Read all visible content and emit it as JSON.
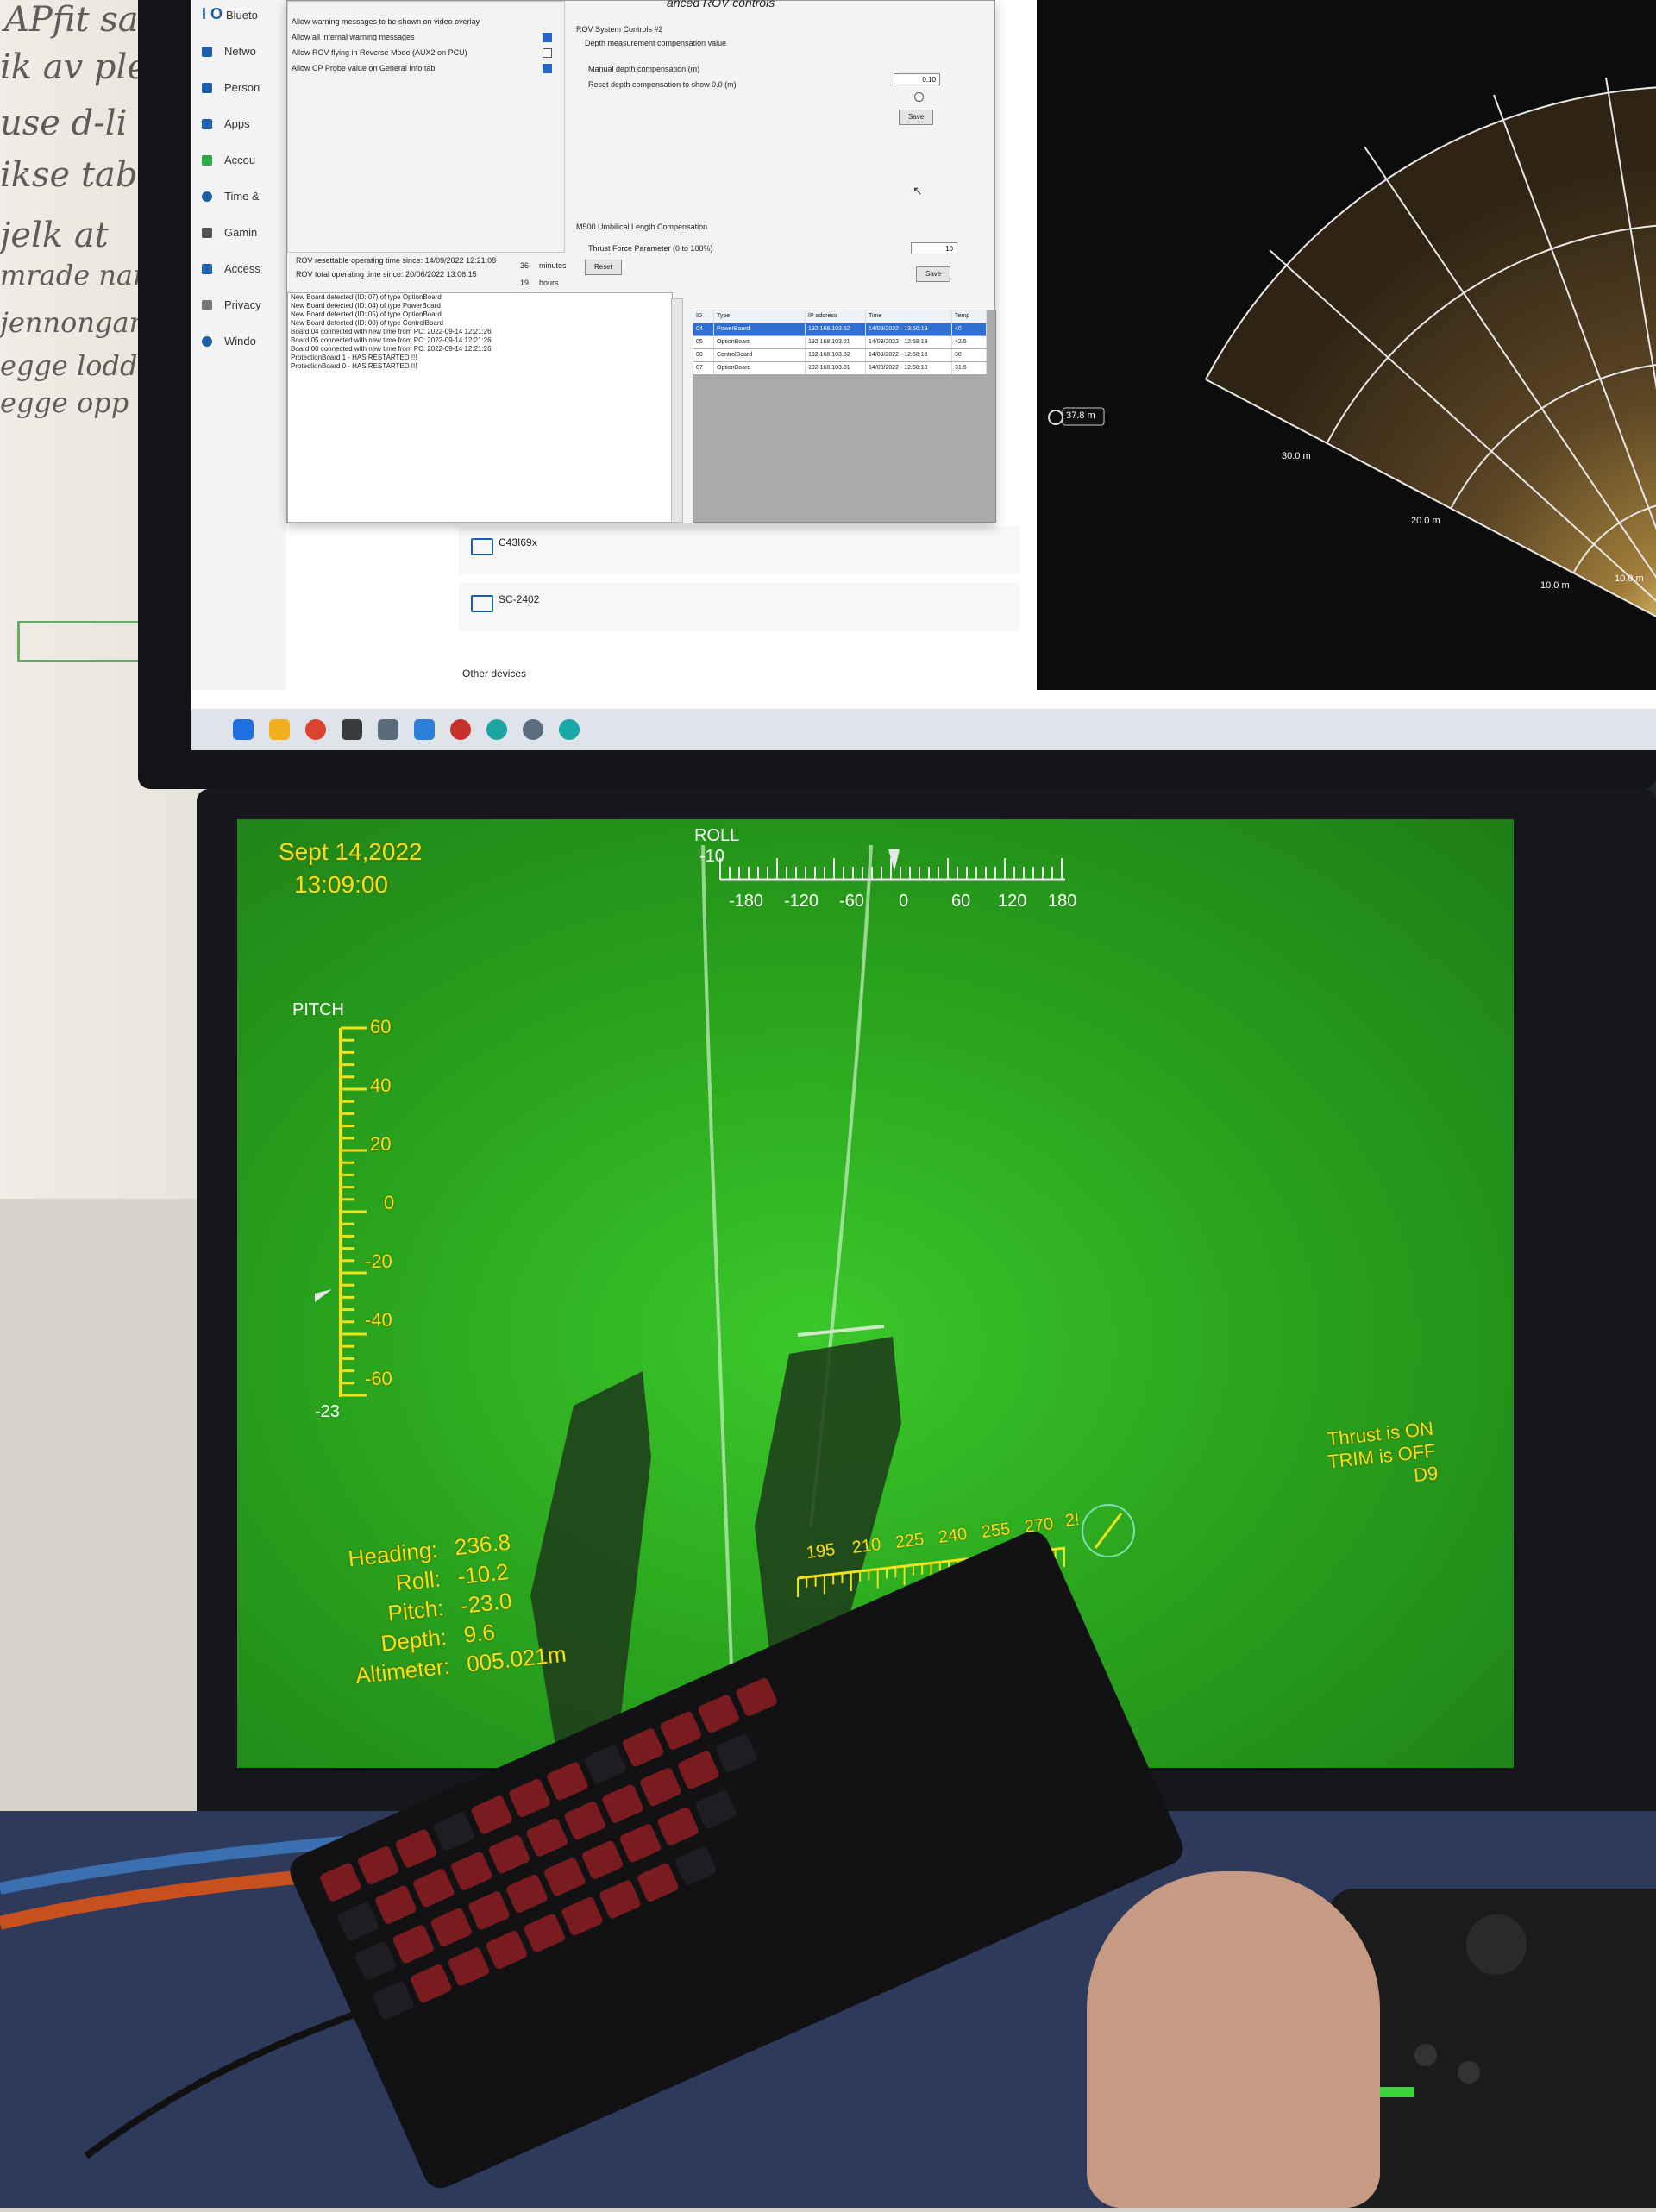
{
  "whiteboard": {
    "lines": [
      "APfit sa",
      "ik av ple",
      "use d-li",
      "ikse tablet",
      "jelk at",
      "mrade nar",
      "jennongar",
      "egge lodd",
      "egge opp"
    ]
  },
  "top_monitor": {
    "settings_sidebar": {
      "items": [
        {
          "label": "Blueto",
          "icon": "bluetooth-icon"
        },
        {
          "label": "Netwo",
          "icon": "network-icon"
        },
        {
          "label": "Person",
          "icon": "personalization-icon"
        },
        {
          "label": "Apps",
          "icon": "apps-icon"
        },
        {
          "label": "Accou",
          "icon": "accounts-icon"
        },
        {
          "label": "Time &",
          "icon": "time-icon"
        },
        {
          "label": "Gamin",
          "icon": "gaming-icon"
        },
        {
          "label": "Access",
          "icon": "accessibility-icon"
        },
        {
          "label": "Privacy",
          "icon": "privacy-icon"
        },
        {
          "label": "Windo",
          "icon": "windows-update-icon"
        }
      ],
      "top_fragment": "I O"
    },
    "devices": [
      {
        "name": "C43I69x"
      },
      {
        "name": "SC-2402"
      }
    ],
    "other_devices_label": "Other devices",
    "rov_dialog": {
      "title": "anced ROV controls",
      "options": [
        {
          "label": "Allow warning messages to be shown on video overlay",
          "checked": false
        },
        {
          "label": "Allow all internal warning messages",
          "checked": true
        },
        {
          "label": "Allow ROV flying in Reverse Mode (AUX2 on PCU)",
          "checked": false
        },
        {
          "label": "Allow CP Probe value on General Info tab",
          "checked": true
        }
      ],
      "system_controls": {
        "group_label": "ROV System Controls #2",
        "depth_label": "Depth measurement compensation value",
        "manual_label": "Manual depth compensation (m)",
        "manual_value": "0.10",
        "reset_label": "Reset depth compensation to show 0.0 (m)",
        "save_label": "Save"
      },
      "umbilical": {
        "group_label": "M500 Umbilical Length Compensation",
        "thrust_label": "Thrust Force Parameter (0 to 100%)",
        "thrust_value": "10",
        "save_label": "Save"
      },
      "operating_time": {
        "resettable_label": "ROV resettable operating time since: 14/09/2022 12:21:08",
        "resettable_value": "36",
        "resettable_unit": "minutes",
        "reset_label": "Reset",
        "total_label": "ROV total operating time since: 20/06/2022 13:06:15",
        "total_value": "19",
        "total_unit": "hours"
      },
      "log": [
        "New Board detected (ID: 07) of type OptionBoard",
        "New Board detected (ID: 04) of type PowerBoard",
        "New Board detected (ID: 05) of type OptionBoard",
        "New Board detected (ID: 00) of type ControlBoard",
        "Board 04 connected with new time from PC: 2022-09-14 12:21:26",
        "Board 05 connected with new time from PC: 2022-09-14 12:21:26",
        "Board 00 connected with new time from PC: 2022-09-14 12:21:26",
        "ProtectionBoard 1 - HAS RESTARTED !!!",
        "ProtectionBoard 0 - HAS RESTARTED !!!"
      ],
      "board_table": {
        "columns": [
          "ID",
          "Type",
          "IP address",
          "Time",
          "Temp"
        ],
        "rows": [
          {
            "id": "04",
            "type": "PowerBoard",
            "ip": "192.168.103.52",
            "time": "14/09/2022 · 13:50:19",
            "temp": "40",
            "selected": true
          },
          {
            "id": "05",
            "type": "OptionBoard",
            "ip": "192.168.103.21",
            "time": "14/09/2022 · 12:58:19",
            "temp": "42.5",
            "selected": false
          },
          {
            "id": "00",
            "type": "ControlBoard",
            "ip": "192.168.103.32",
            "time": "14/09/2022 · 12:58:19",
            "temp": "38",
            "selected": false
          },
          {
            "id": "07",
            "type": "OptionBoard",
            "ip": "192.168.103.31",
            "time": "14/09/2022 · 12:58:19",
            "temp": "31.5",
            "selected": false
          }
        ]
      }
    },
    "sonar": {
      "range_badge": "37.8 m",
      "range_labels": [
        "30.0 m",
        "20.0 m",
        "10.0 m",
        "10.0 m"
      ]
    },
    "taskbar_icons": [
      {
        "name": "windows-start-icon",
        "color": "#1f6fe0"
      },
      {
        "name": "file-explorer-icon",
        "color": "#f2b01e"
      },
      {
        "name": "chrome-icon",
        "color": "#d9432f"
      },
      {
        "name": "app-s-icon",
        "color": "#3a3a3a"
      },
      {
        "name": "app-window-icon",
        "color": "#5a6b7a"
      },
      {
        "name": "wifi-icon",
        "color": "#2b7fd9"
      },
      {
        "name": "app-red-icon",
        "color": "#c9302c"
      },
      {
        "name": "app-teal-icon",
        "color": "#1aa5a0"
      },
      {
        "name": "settings-gear-icon",
        "color": "#5b6c80"
      },
      {
        "name": "app-sonar-icon",
        "color": "#19a8a8"
      }
    ]
  },
  "hud": {
    "date": "Sept 14,2022",
    "time": "13:09:00",
    "roll_label": "ROLL",
    "roll_value": "-10",
    "roll_ticks": [
      "-180",
      "-120",
      "-60",
      "0",
      "60",
      "120",
      "180"
    ],
    "pitch_label": "PITCH",
    "pitch_ticks": [
      "60",
      "40",
      "20",
      "0",
      "-20",
      "-40",
      "-60"
    ],
    "pitch_value": "-23",
    "heading_ticks": [
      "195",
      "210",
      "225",
      "240",
      "255",
      "270",
      "2!"
    ],
    "readouts": [
      {
        "label": "Heading:",
        "value": "236.8"
      },
      {
        "label": "Roll:",
        "value": "-10.2"
      },
      {
        "label": "Pitch:",
        "value": "-23.0"
      },
      {
        "label": "Depth:",
        "value": "9.6"
      },
      {
        "label": "Altimeter:",
        "value": "005.021m"
      }
    ],
    "status": {
      "thrust": "Thrust is ON",
      "trim": "TRIM is OFF",
      "code": "D9"
    },
    "colors": {
      "hud_yellow": "#f0e21a",
      "underwater_green": "#2aa51e"
    }
  }
}
